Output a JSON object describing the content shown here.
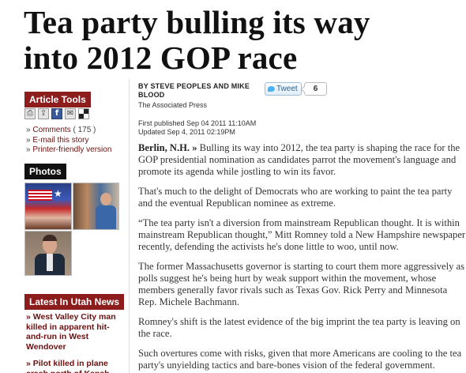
{
  "headline": {
    "line1": "Tea party bulling its way",
    "line2": "into 2012 GOP race"
  },
  "sidebar": {
    "tools_label": "Article Tools",
    "tool_icons": [
      "print-icon",
      "share-icon",
      "facebook-icon",
      "email-icon",
      "mixx-icon"
    ],
    "links": [
      {
        "prefix": "» ",
        "label": "Comments",
        "suffix": " ( 175 )"
      },
      {
        "prefix": "» ",
        "label": "E-mail this story",
        "suffix": ""
      },
      {
        "prefix": "» ",
        "label": "Printer-friendly version",
        "suffix": ""
      }
    ],
    "photos_label": "Photos",
    "news_label": "Latest In Utah News",
    "news_items": [
      "» West Valley City man killed in apparent hit-and-run in West Wendover",
      "» Pilot killed in plane crash north of Kanab"
    ]
  },
  "byline": {
    "authors": "BY STEVE PEOPLES AND MIKE BLOOD",
    "agency": "The Associated Press",
    "published": "First published Sep 04 2011 11:10AM",
    "updated": "Updated Sep 4, 2011 02:19PM"
  },
  "tweet": {
    "label": "Tweet",
    "count": "6"
  },
  "article": {
    "dateline": "Berlin, N.H. »",
    "paragraphs": [
      " Bulling its way into 2012, the tea party is shaping the race for the GOP presidential nomination as candidates parrot the movement's language and promote its agenda while jostling to win its favor.",
      "That's much to the delight of Democrats who are working to paint the tea party and the eventual Republican nominee as extreme.",
      "“The tea party isn't a diversion from mainstream Republican thought. It is within mainstream Republican thought,” Mitt Romney told a New Hampshire newspaper recently, defending the activists he's done little to woo, until now.",
      "The former Massachusetts governor is starting to court them more aggressively as polls suggest he's being hurt by weak support within the movement, whose members generally favor rivals such as Texas Gov. Rick Perry and Minnesota Rep. Michele Bachmann.",
      "Romney's shift is the latest evidence of the big imprint the tea party is leaving on the race.",
      "Such overtures come with risks, given that more Americans are cooling to the tea party's unyielding tactics and bare-bones vision of the federal government."
    ]
  }
}
